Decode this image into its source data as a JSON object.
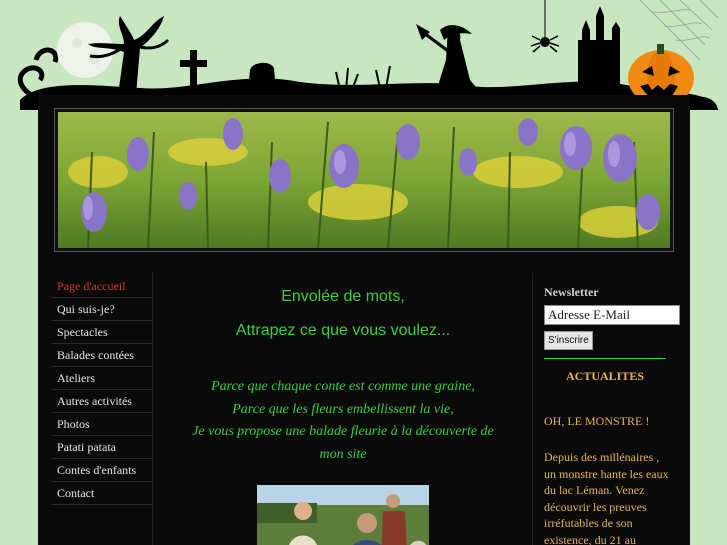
{
  "nav": {
    "items": [
      {
        "label": "Page d'accueil",
        "active": true
      },
      {
        "label": "Qui suis-je?"
      },
      {
        "label": "Spectacles"
      },
      {
        "label": "Balades contées"
      },
      {
        "label": "Ateliers"
      },
      {
        "label": "Autres activités"
      },
      {
        "label": "Photos"
      },
      {
        "label": "Patati patata"
      },
      {
        "label": "Contes d'enfants"
      },
      {
        "label": "Contact"
      }
    ]
  },
  "main": {
    "headline1": "Envolée de mots,",
    "headline2": "Attrapez ce que vous voulez...",
    "intro": [
      "Parce que chaque conte est comme une graine,",
      "Parce que les fleurs embellissent la vie,",
      "Je vous propose une balade fleurie à la découverte de",
      "mon site"
    ]
  },
  "newsletter": {
    "title": "Newsletter",
    "email_value": "Adresse E-Mail",
    "subscribe_label": "S'inscrire"
  },
  "news": {
    "title": "ACTUALITES",
    "headline": "OH, LE MONSTRE !",
    "body": "Depuis des millénaires , un monstre hante les eaux du lac Léman. Venez découvrir les preuves irréfutables de son existence, du 21 au"
  },
  "icons": {
    "moon": "moon-icon",
    "pumpkin": "pumpkin-icon",
    "witch": "witch-icon",
    "cross": "cross-icon",
    "castle": "castle-icon",
    "spider": "spider-icon",
    "tree": "dead-tree-icon",
    "web": "spiderweb-icon"
  },
  "colors": {
    "background": "#c8e6c0",
    "panel": "#0a0a0a",
    "green_text": "#3ad13a",
    "active_nav": "#d23a2a",
    "news_text": "#e8b45a"
  }
}
